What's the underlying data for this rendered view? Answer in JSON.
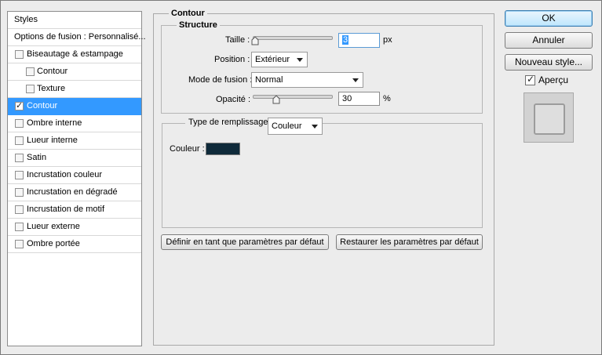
{
  "sidebar": {
    "header": "Styles",
    "blend_options": "Options de fusion : Personnalisé...",
    "items": [
      {
        "label": "Biseautage & estampage",
        "checked": false,
        "indent": false,
        "selected": false
      },
      {
        "label": "Contour",
        "checked": false,
        "indent": true,
        "selected": false
      },
      {
        "label": "Texture",
        "checked": false,
        "indent": true,
        "selected": false
      },
      {
        "label": "Contour",
        "checked": true,
        "indent": false,
        "selected": true
      },
      {
        "label": "Ombre interne",
        "checked": false,
        "indent": false,
        "selected": false
      },
      {
        "label": "Lueur interne",
        "checked": false,
        "indent": false,
        "selected": false
      },
      {
        "label": "Satin",
        "checked": false,
        "indent": false,
        "selected": false
      },
      {
        "label": "Incrustation couleur",
        "checked": false,
        "indent": false,
        "selected": false
      },
      {
        "label": "Incrustation en dégradé",
        "checked": false,
        "indent": false,
        "selected": false
      },
      {
        "label": "Incrustation de motif",
        "checked": false,
        "indent": false,
        "selected": false
      },
      {
        "label": "Lueur externe",
        "checked": false,
        "indent": false,
        "selected": false
      },
      {
        "label": "Ombre portée",
        "checked": false,
        "indent": false,
        "selected": false
      }
    ]
  },
  "panel": {
    "title": "Contour",
    "structure": {
      "title": "Structure",
      "size_label": "Taille :",
      "size_value": "3",
      "size_unit": "px",
      "position_label": "Position :",
      "position_value": "Extérieur",
      "blend_label": "Mode de fusion :",
      "blend_value": "Normal",
      "opacity_label": "Opacité :",
      "opacity_value": "30",
      "opacity_unit": "%"
    },
    "fill": {
      "type_label": "Type de remplissage :",
      "type_value": "Couleur",
      "color_label": "Couleur :",
      "color_hex": "#0f2a3a"
    },
    "make_default": "Définir en tant que paramètres par défaut",
    "reset_default": "Restaurer les paramètres par défaut"
  },
  "actions": {
    "ok": "OK",
    "cancel": "Annuler",
    "new_style": "Nouveau style...",
    "preview_label": "Aperçu",
    "preview_checked": true
  }
}
